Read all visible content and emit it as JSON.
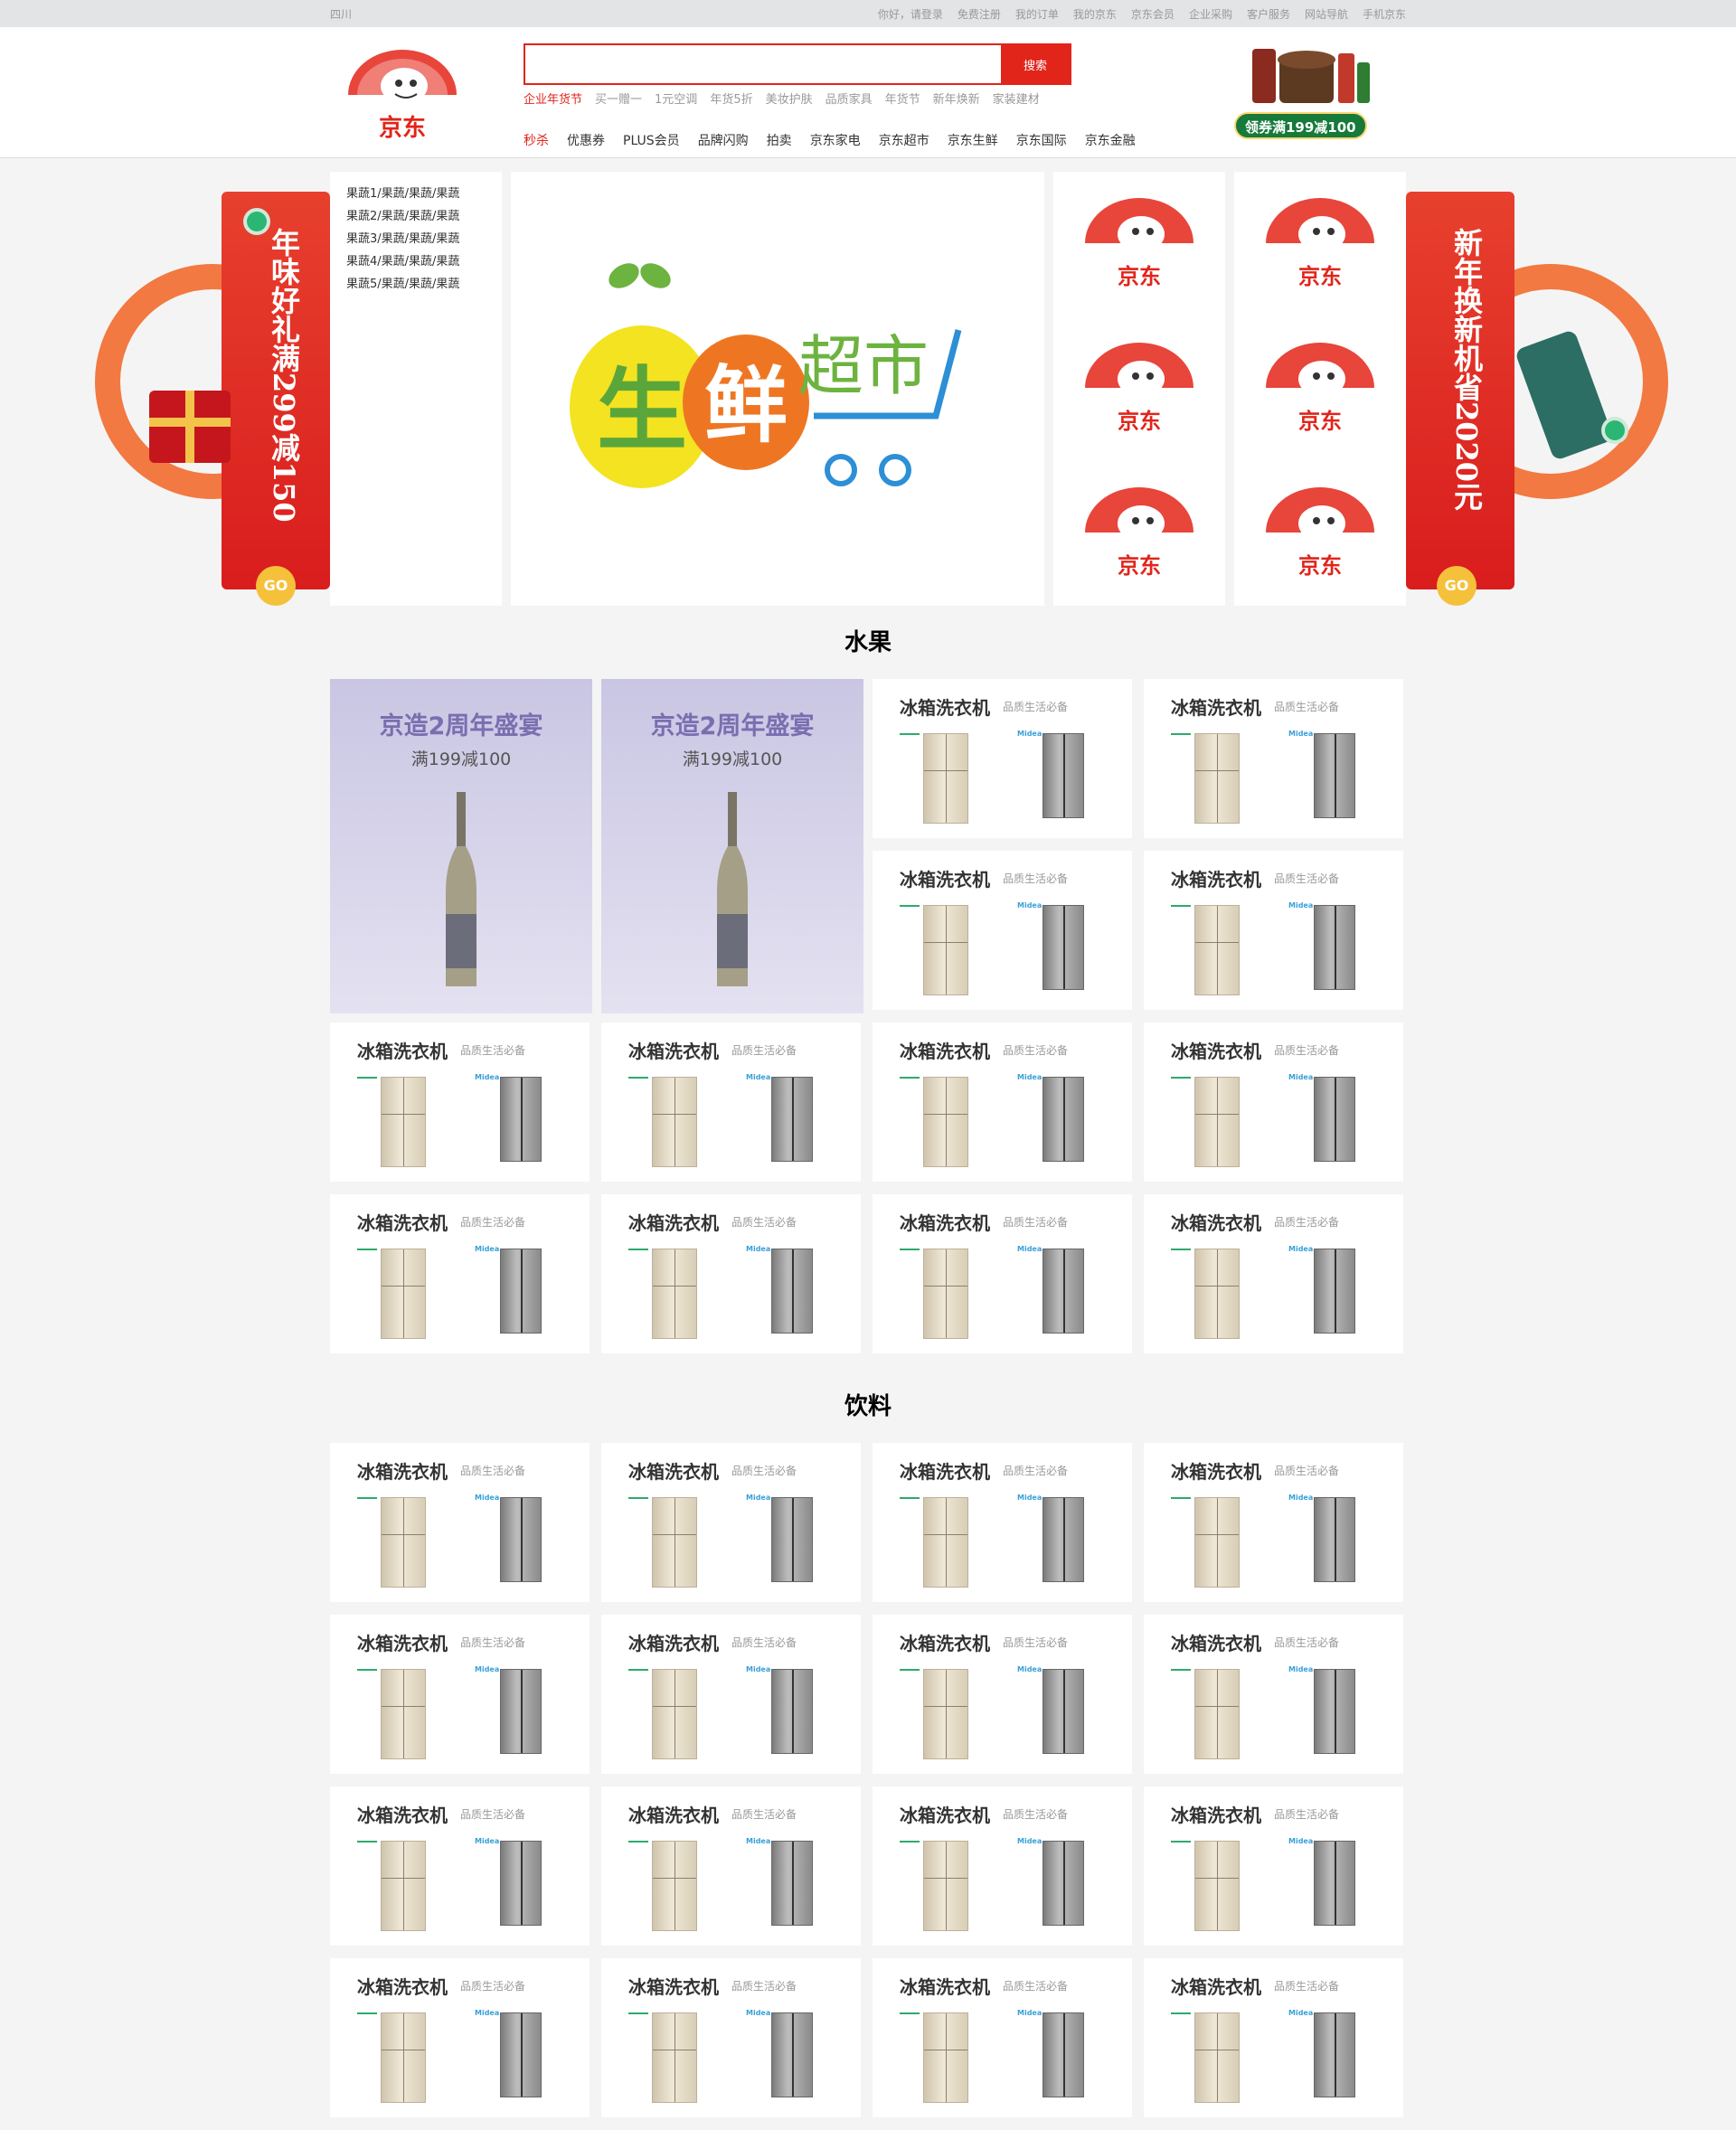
{
  "topbar": {
    "location": "四川",
    "links": [
      "你好，请登录",
      "免费注册",
      "我的订单",
      "我的京东",
      "京东会员",
      "企业采购",
      "客户服务",
      "网站导航",
      "手机京东"
    ]
  },
  "header": {
    "logo_text": "京东",
    "search": {
      "value": "",
      "placeholder": "",
      "button": "搜索"
    },
    "hotwords": [
      "企业年货节",
      "买一赠一",
      "1元空调",
      "年货5折",
      "美妆护肤",
      "品质家具",
      "年货节",
      "新年焕新",
      "家装建材"
    ],
    "navs": [
      "秒杀",
      "优惠券",
      "PLUS会员",
      "品牌闪购",
      "拍卖",
      "京东家电",
      "京东超市",
      "京东生鲜",
      "京东国际",
      "京东金融"
    ],
    "promo_badge": "领券满199减100"
  },
  "banner": {
    "left_art": {
      "slogan": "年味好礼满299减150",
      "go": "GO"
    },
    "right_art": {
      "slogan": "新年换新机省2020元",
      "go": "GO"
    },
    "categories": [
      "果蔬1/果蔬/果蔬/果蔬",
      "果蔬2/果蔬/果蔬/果蔬",
      "果蔬3/果蔬/果蔬/果蔬",
      "果蔬4/果蔬/果蔬/果蔬",
      "果蔬5/果蔬/果蔬/果蔬"
    ],
    "main_logo": {
      "char1": "生",
      "char2": "鲜",
      "char3": "超市"
    },
    "tiles": [
      "京东",
      "京东",
      "京东",
      "京东",
      "京东",
      "京东"
    ]
  },
  "sections": [
    {
      "title": "水果",
      "wine": {
        "title": "京造2周年盛宴",
        "subtitle": "满199减100"
      },
      "card": {
        "title": "冰箱洗衣机",
        "subtitle": "品质生活必备",
        "brand": "Midea"
      }
    },
    {
      "title": "饮料",
      "card": {
        "title": "冰箱洗衣机",
        "subtitle": "品质生活必备",
        "brand": "Midea"
      }
    }
  ],
  "colors": {
    "brand_red": "#e1251b",
    "bg": "#f4f4f4",
    "wine_purple": "#7a6eb0"
  }
}
